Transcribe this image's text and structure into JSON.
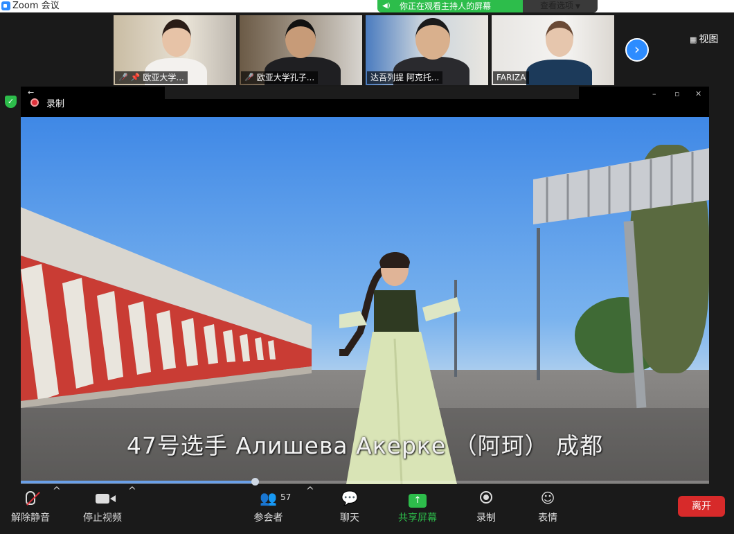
{
  "window": {
    "title": "Zoom 会议"
  },
  "banner": {
    "sharing_text": "你正在观看主持人的屏幕",
    "view_options": "查看选项"
  },
  "participants": [
    {
      "name": "欧亚大学...",
      "muted": true,
      "pinned": true,
      "active": true
    },
    {
      "name": "欧亚大学孔子...",
      "muted": true,
      "pinned": false,
      "active": false
    },
    {
      "name": "达吾列提 阿克托...",
      "muted": false,
      "pinned": false,
      "active": false
    },
    {
      "name": "FARIZA",
      "muted": false,
      "pinned": false,
      "active": false
    }
  ],
  "view_button": "视图",
  "recording": {
    "label": "录制"
  },
  "video": {
    "subtitle": "47号选手 Алишева Акерке （阿珂） 成都",
    "progress": 0.34
  },
  "toolbar": {
    "unmute": "解除静音",
    "stop_video": "停止视频",
    "participants": "参会者",
    "participants_count": "57",
    "chat": "聊天",
    "share_screen": "共享屏幕",
    "record": "录制",
    "reactions": "表情",
    "leave": "离开"
  },
  "colors": {
    "brand_blue": "#2d8cff",
    "share_green": "#2dbd4b",
    "leave_red": "#d72a2a",
    "active_border": "#74c043"
  }
}
